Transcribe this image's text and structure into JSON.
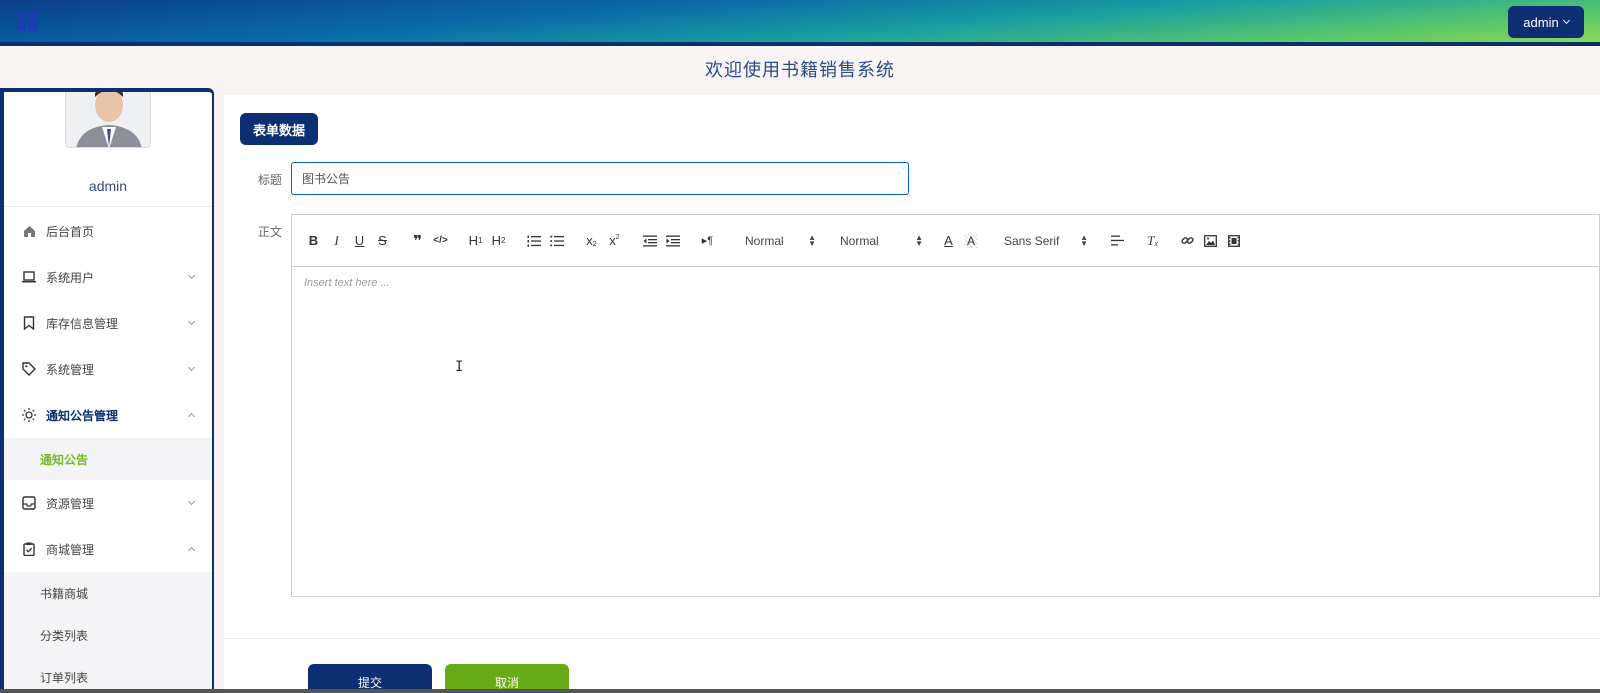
{
  "header": {
    "user_label": "admin"
  },
  "welcome": "欢迎使用书籍销售系统",
  "sidebar": {
    "username": "admin",
    "items": [
      {
        "label": "后台首页"
      },
      {
        "label": "系统用户"
      },
      {
        "label": "库存信息管理"
      },
      {
        "label": "系统管理"
      },
      {
        "label": "通知公告管理"
      },
      {
        "label": "资源管理"
      },
      {
        "label": "商城管理"
      }
    ],
    "sub_notice": [
      {
        "label": "通知公告"
      }
    ],
    "sub_mall": [
      {
        "label": "书籍商城"
      },
      {
        "label": "分类列表"
      },
      {
        "label": "订单列表"
      }
    ]
  },
  "form": {
    "tag": "表单数据",
    "title_label": "标题",
    "title_value": "图书公告",
    "body_label": "正文",
    "editor": {
      "size_select": "Normal",
      "header_select": "Normal",
      "font_select": "Sans Serif",
      "placeholder": "Insert text here ..."
    },
    "submit": "提交",
    "cancel": "取消"
  },
  "colors": {
    "primary": "#0b2f72",
    "accent_green": "#68ab18",
    "active_sub": "#7ab828"
  }
}
